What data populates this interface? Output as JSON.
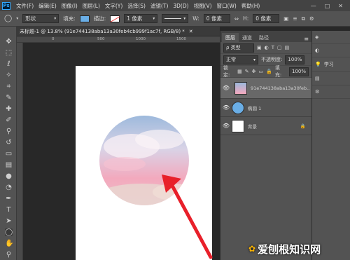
{
  "menu": {
    "logo": "Ps",
    "items": [
      "文件(F)",
      "编辑(E)",
      "图像(I)",
      "图层(L)",
      "文字(Y)",
      "选择(S)",
      "滤镜(T)",
      "3D(D)",
      "视图(V)",
      "窗口(W)",
      "帮助(H)"
    ],
    "window_buttons": [
      "—",
      "□",
      "✕"
    ]
  },
  "options": {
    "shape_mode": "形状",
    "fill_label": "填充:",
    "stroke_label": "描边:",
    "stroke_size": "1 像素",
    "w_label": "W:",
    "w_value": "0 像素",
    "h_label": "H:",
    "h_value": "0 像素",
    "fill_color": "#6aaee6"
  },
  "document": {
    "tab_title": "未标题-1 @ 13.8% (91e744138aba13a30feb4cb999f1ac7f, RGB/8) *",
    "ruler_marks": [
      "0",
      "500",
      "1000",
      "1500"
    ]
  },
  "layers_panel": {
    "tabs": [
      "图层",
      "通道",
      "路径"
    ],
    "filter_label": "ρ 类型",
    "blend_mode": "正常",
    "opacity_label": "不透明度:",
    "opacity_value": "100%",
    "lock_label": "锁定:",
    "fill_label": "填充:",
    "fill_value": "100%",
    "layers": [
      {
        "name": "91e744138aba13a30feb...",
        "selected": true
      },
      {
        "name": "椭圆 1",
        "selected": false
      },
      {
        "name": "背景",
        "selected": false
      }
    ]
  },
  "dock": {
    "items": [
      "",
      "",
      "学习",
      "",
      ""
    ]
  },
  "watermark": {
    "text": "爱刨根知识网"
  },
  "colors": {
    "accent_arrow": "#e8202a",
    "circle_pink": "#f2a3b8",
    "sky_blue": "#8fb4da"
  }
}
